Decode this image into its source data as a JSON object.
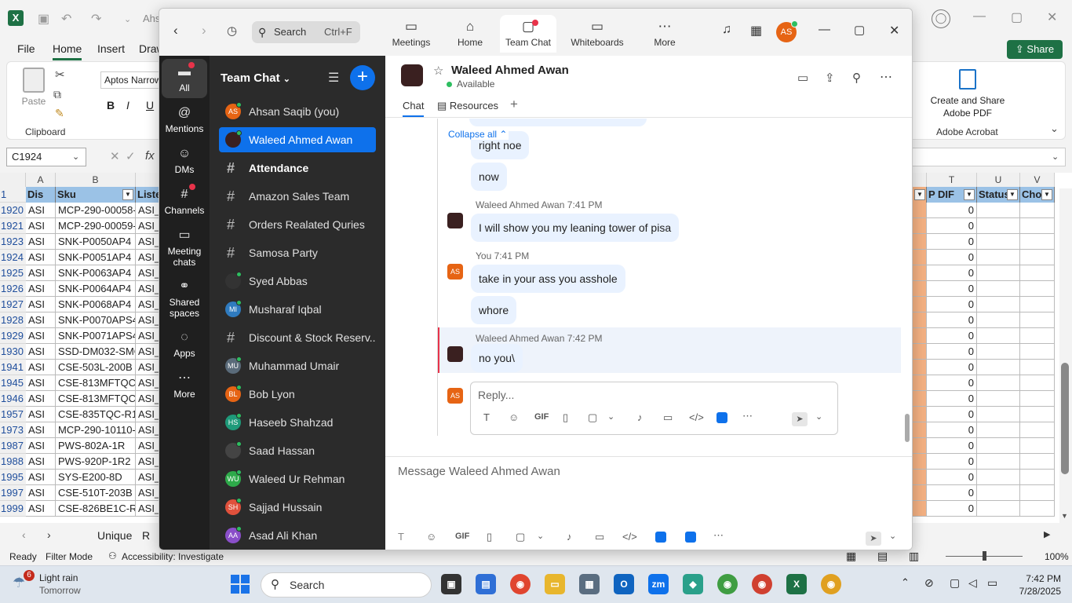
{
  "excel": {
    "app_letter": "X",
    "doc_title": "Ahs",
    "tabs": [
      "File",
      "Home",
      "Insert",
      "Draw"
    ],
    "share_label": "Share",
    "clipboard": {
      "paste_label": "Paste",
      "group_label": "Clipboard"
    },
    "font_name": "Aptos Narrow",
    "font_buttons": [
      "B",
      "I",
      "U"
    ],
    "acrobat": {
      "button_label": "Create and Share Adobe PDF",
      "group_label": "Adobe Acrobat"
    },
    "name_box": "C1924",
    "fx_label": "fx",
    "columns": {
      "a": "A",
      "b": "B",
      "t": "T",
      "u": "U",
      "v": "V"
    },
    "header_row": {
      "num": "1",
      "a": "Dis",
      "b": "Sku",
      "c": "Liste",
      "t": "P DIF",
      "u": "Status",
      "v": "Cho"
    },
    "rows": [
      {
        "num": "1920",
        "a": "ASI",
        "b": "MCP-290-00058-",
        "c": "ASI_",
        "t": "0"
      },
      {
        "num": "1921",
        "a": "ASI",
        "b": "MCP-290-00059-",
        "c": "ASI_",
        "t": "0"
      },
      {
        "num": "1923",
        "a": "ASI",
        "b": "SNK-P0050AP4",
        "c": "ASI_",
        "t": "0"
      },
      {
        "num": "1924",
        "a": "ASI",
        "b": "SNK-P0051AP4",
        "c": "ASI_",
        "t": "0"
      },
      {
        "num": "1925",
        "a": "ASI",
        "b": "SNK-P0063AP4",
        "c": "ASI_",
        "t": "0"
      },
      {
        "num": "1926",
        "a": "ASI",
        "b": "SNK-P0064AP4",
        "c": "ASI_",
        "t": "0"
      },
      {
        "num": "1927",
        "a": "ASI",
        "b": "SNK-P0068AP4",
        "c": "ASI_",
        "t": "0"
      },
      {
        "num": "1928",
        "a": "ASI",
        "b": "SNK-P0070APS4",
        "c": "ASI_",
        "t": "0"
      },
      {
        "num": "1929",
        "a": "ASI",
        "b": "SNK-P0071APS4",
        "c": "ASI_",
        "t": "0"
      },
      {
        "num": "1930",
        "a": "ASI",
        "b": "SSD-DM032-SMC",
        "c": "ASI_",
        "t": "0"
      },
      {
        "num": "1941",
        "a": "ASI",
        "b": "CSE-503L-200B",
        "c": "ASI_",
        "t": "0"
      },
      {
        "num": "1945",
        "a": "ASI",
        "b": "CSE-813MFTQC-",
        "c": "ASI_",
        "t": "0"
      },
      {
        "num": "1946",
        "a": "ASI",
        "b": "CSE-813MFTQC-",
        "c": "ASI_",
        "t": "0"
      },
      {
        "num": "1957",
        "a": "ASI",
        "b": "CSE-835TQC-R1",
        "c": "ASI_",
        "t": "0"
      },
      {
        "num": "1973",
        "a": "ASI",
        "b": "MCP-290-10110-",
        "c": "ASI_",
        "t": "0"
      },
      {
        "num": "1987",
        "a": "ASI",
        "b": "PWS-802A-1R",
        "c": "ASI_",
        "t": "0"
      },
      {
        "num": "1988",
        "a": "ASI",
        "b": "PWS-920P-1R2",
        "c": "ASI_",
        "t": "0"
      },
      {
        "num": "1995",
        "a": "ASI",
        "b": "SYS-E200-8D",
        "c": "ASI_",
        "t": "0"
      },
      {
        "num": "1997",
        "a": "ASI",
        "b": "CSE-510T-203B",
        "c": "ASI_",
        "t": "0"
      },
      {
        "num": "1999",
        "a": "ASI",
        "b": "CSE-826BE1C-R9",
        "c": "ASI_",
        "t": "0"
      }
    ],
    "sheet_tabs": [
      "Unique",
      "R"
    ],
    "status": {
      "ready": "Ready",
      "filter": "Filter Mode",
      "accessibility": "Accessibility: Investigate",
      "zoom": "100%"
    }
  },
  "zoom": {
    "search_label": "Search",
    "search_shortcut": "Ctrl+F",
    "top_tabs": [
      {
        "label": "Meetings",
        "icon": "video-camera-icon"
      },
      {
        "label": "Home",
        "icon": "home-icon"
      },
      {
        "label": "Team Chat",
        "icon": "chat-icon"
      },
      {
        "label": "Whiteboards",
        "icon": "whiteboard-icon"
      },
      {
        "label": "More",
        "icon": "more-icon"
      }
    ],
    "user_initials": "AS",
    "rail": [
      {
        "label": "All"
      },
      {
        "label": "Mentions"
      },
      {
        "label": "DMs"
      },
      {
        "label": "Channels"
      },
      {
        "label": "Meeting chats"
      },
      {
        "label": "Shared spaces"
      },
      {
        "label": "Apps"
      },
      {
        "label": "More"
      }
    ],
    "list_title": "Team Chat",
    "list_items": [
      {
        "label": "Ahsan Saqib (you)",
        "initials": "AS",
        "color": "#e66414"
      },
      {
        "label": "Waleed Ahmed Awan",
        "initials": "",
        "color": "#3a2020"
      },
      {
        "label": "Attendance",
        "initials": "",
        "color": ""
      },
      {
        "label": "Amazon Sales Team",
        "initials": "",
        "color": ""
      },
      {
        "label": "Orders Realated Quries",
        "initials": "",
        "color": ""
      },
      {
        "label": "Samosa Party",
        "initials": "",
        "color": ""
      },
      {
        "label": "Syed Abbas",
        "initials": "",
        "color": "#333333"
      },
      {
        "label": "Musharaf Iqbal",
        "initials": "MI",
        "color": "#2f7bbf"
      },
      {
        "label": "Discount & Stock Reserv...",
        "initials": "",
        "color": ""
      },
      {
        "label": "Muhammad Umair",
        "initials": "MU",
        "color": "#5a6b7a"
      },
      {
        "label": "Bob Lyon",
        "initials": "BL",
        "color": "#e66414"
      },
      {
        "label": "Haseeb Shahzad",
        "initials": "HS",
        "color": "#1e9a7a"
      },
      {
        "label": "Saad Hassan",
        "initials": "",
        "color": "#444444"
      },
      {
        "label": "Waleed Ur Rehman",
        "initials": "WU",
        "color": "#2eaa4a"
      },
      {
        "label": "Sajjad Hussain",
        "initials": "SH",
        "color": "#e0513c"
      },
      {
        "label": "Asad Ali Khan",
        "initials": "AA",
        "color": "#8a4fc9"
      }
    ],
    "chat": {
      "name": "Waleed Ahmed Awan",
      "status": "Available",
      "tabs": [
        "Chat",
        "Resources"
      ],
      "collapse_label": "Collapse all",
      "messages": [
        {
          "text": "right noe"
        },
        {
          "text": "now"
        },
        {
          "sender": "Waleed Ahmed Awan",
          "time": "7:41 PM",
          "text": "I will show you my leaning tower of pisa"
        },
        {
          "sender": "You",
          "time": "7:41 PM",
          "text": "take in your ass you asshole"
        },
        {
          "text": "whore"
        },
        {
          "sender": "Waleed Ahmed Awan",
          "time": "7:42 PM",
          "text": "no you\\"
        }
      ],
      "my_initials": "AS",
      "reply_placeholder": "Reply...",
      "compose_placeholder": "Message Waleed Ahmed Awan",
      "gif_label": "GIF"
    }
  },
  "taskbar": {
    "weather": {
      "badge": "6",
      "title": "Light rain",
      "subtitle": "Tomorrow"
    },
    "search_label": "Search",
    "clock": {
      "time": "7:42 PM",
      "date": "7/28/2025"
    }
  },
  "colors": {
    "accent": "#0e71eb",
    "excel_green": "#1e7145",
    "header_blue": "#9bc2e6",
    "salmon": "#f4b183"
  }
}
